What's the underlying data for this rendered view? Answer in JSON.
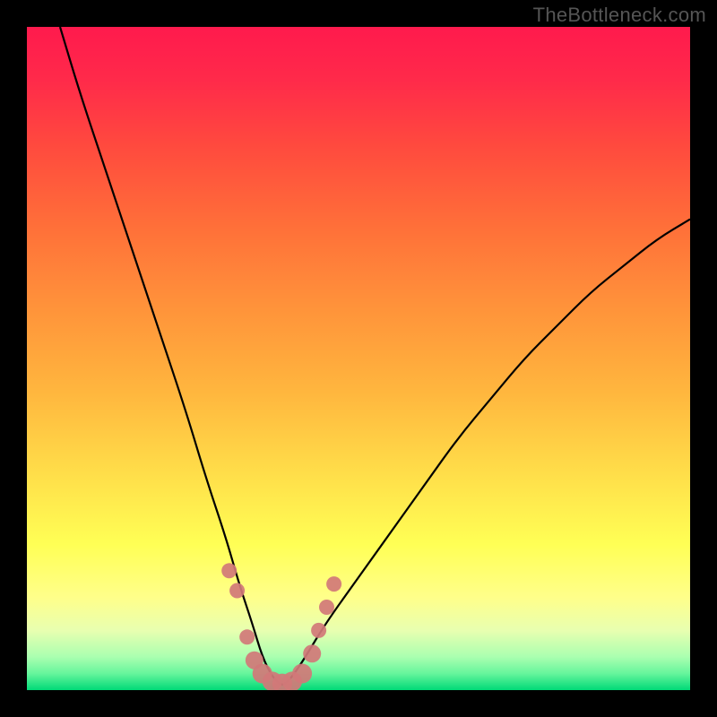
{
  "watermark": "TheBottleneck.com",
  "gradient": {
    "stops": [
      {
        "offset": 0.0,
        "color": "#ff1a4d"
      },
      {
        "offset": 0.08,
        "color": "#ff2a4a"
      },
      {
        "offset": 0.18,
        "color": "#ff4a3e"
      },
      {
        "offset": 0.3,
        "color": "#ff6f39"
      },
      {
        "offset": 0.42,
        "color": "#ff923a"
      },
      {
        "offset": 0.55,
        "color": "#ffb63e"
      },
      {
        "offset": 0.68,
        "color": "#ffe04a"
      },
      {
        "offset": 0.78,
        "color": "#ffff55"
      },
      {
        "offset": 0.86,
        "color": "#ffff8a"
      },
      {
        "offset": 0.91,
        "color": "#e8ffb0"
      },
      {
        "offset": 0.95,
        "color": "#aaffb0"
      },
      {
        "offset": 0.975,
        "color": "#66f59c"
      },
      {
        "offset": 1.0,
        "color": "#00d977"
      }
    ]
  },
  "chart_data": {
    "type": "line",
    "title": "",
    "xlabel": "",
    "ylabel": "",
    "xlim": [
      0,
      100
    ],
    "ylim": [
      0,
      100
    ],
    "series": [
      {
        "name": "bottleneck-curve",
        "x": [
          5,
          8,
          12,
          16,
          20,
          24,
          27,
          30,
          32,
          34,
          35.5,
          37,
          38.5,
          40,
          42,
          45,
          50,
          55,
          60,
          65,
          70,
          75,
          80,
          85,
          90,
          95,
          100
        ],
        "y": [
          100,
          90,
          78,
          66,
          54,
          42,
          32,
          23,
          16,
          10,
          5,
          2,
          0.5,
          2,
          5,
          10,
          17,
          24,
          31,
          38,
          44,
          50,
          55,
          60,
          64,
          68,
          71
        ]
      }
    ],
    "markers": {
      "name": "data-points",
      "color": "#d17878",
      "points": [
        {
          "x": 30.5,
          "y": 18
        },
        {
          "x": 31.7,
          "y": 15
        },
        {
          "x": 33.2,
          "y": 8
        },
        {
          "x": 34.3,
          "y": 4.5
        },
        {
          "x": 35.5,
          "y": 2.5
        },
        {
          "x": 37.0,
          "y": 1.3
        },
        {
          "x": 38.5,
          "y": 1.0
        },
        {
          "x": 40.0,
          "y": 1.3
        },
        {
          "x": 41.5,
          "y": 2.5
        },
        {
          "x": 43.0,
          "y": 5.5
        },
        {
          "x": 44.0,
          "y": 9
        },
        {
          "x": 45.2,
          "y": 12.5
        },
        {
          "x": 46.3,
          "y": 16
        }
      ]
    }
  }
}
